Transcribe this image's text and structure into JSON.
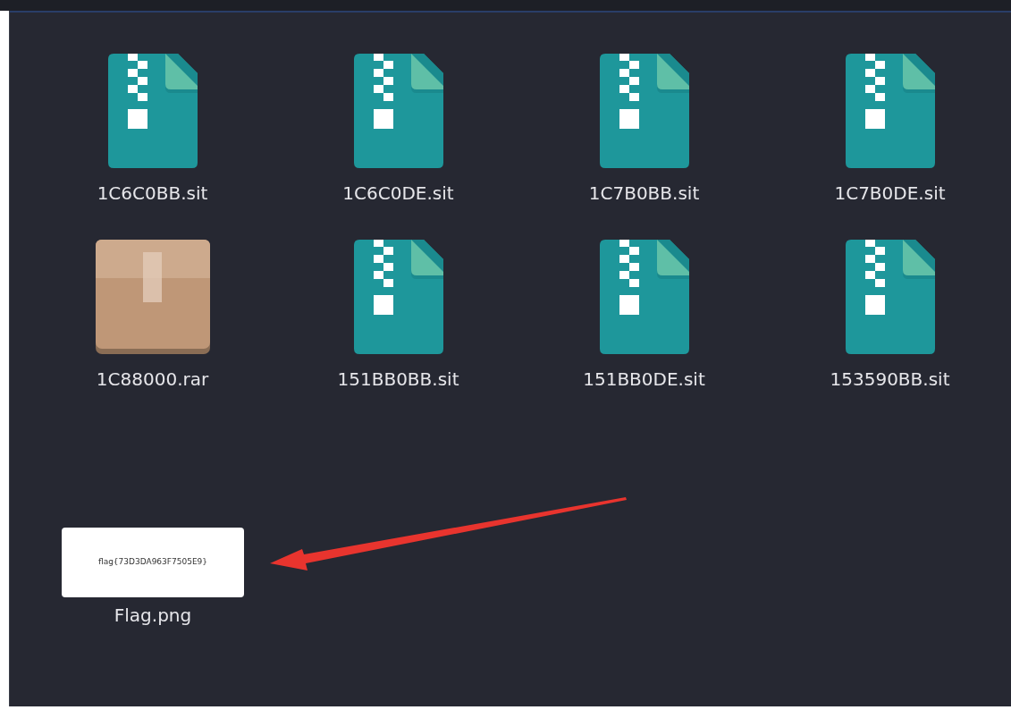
{
  "files": [
    {
      "name": "1C6C0BB.sit",
      "kind": "archive"
    },
    {
      "name": "1C6C0DE.sit",
      "kind": "archive"
    },
    {
      "name": "1C7B0BB.sit",
      "kind": "archive"
    },
    {
      "name": "1C7B0DE.sit",
      "kind": "archive"
    },
    {
      "name": "1C88000.rar",
      "kind": "package"
    },
    {
      "name": "151BB0BB.sit",
      "kind": "archive"
    },
    {
      "name": "151BB0DE.sit",
      "kind": "archive"
    },
    {
      "name": "153590BB.sit",
      "kind": "archive"
    }
  ],
  "image_file": {
    "name": "Flag.png",
    "preview_text": "flag{73D3DA963F7505E9}"
  }
}
